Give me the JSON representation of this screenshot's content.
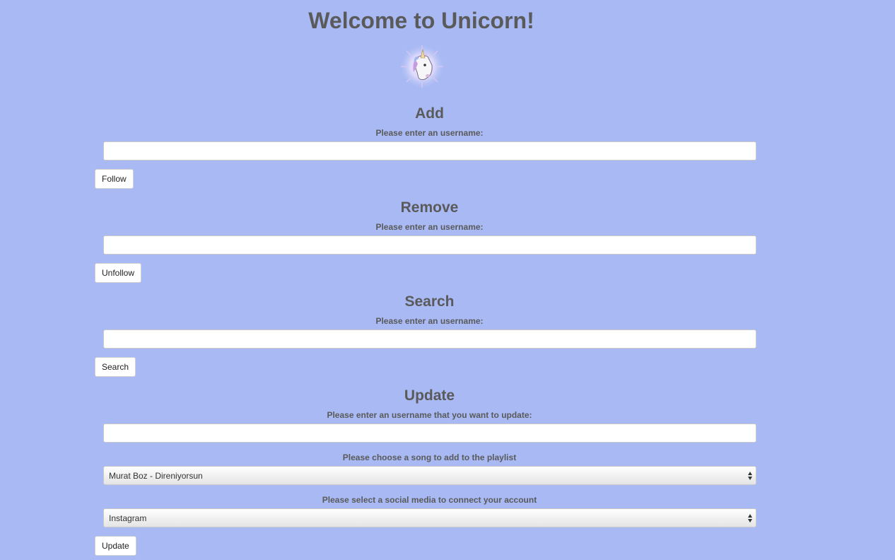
{
  "title": "Welcome to Unicorn!",
  "logo_icon": "unicorn-icon",
  "add": {
    "heading": "Add",
    "label": "Please enter an username:",
    "input_value": "",
    "button_label": "Follow"
  },
  "remove": {
    "heading": "Remove",
    "label": "Please enter an username:",
    "input_value": "",
    "button_label": "Unfollow"
  },
  "search": {
    "heading": "Search",
    "label": "Please enter an username:",
    "input_value": "",
    "button_label": "Search"
  },
  "update": {
    "heading": "Update",
    "username_label": "Please enter an username that you want to update:",
    "username_value": "",
    "song_label": "Please choose a song to add to the playlist",
    "song_selected": "Murat Boz - Direniyorsun",
    "social_label": "Please select a social media to connect your account",
    "social_selected": "Instagram",
    "button_label": "Update"
  },
  "colors": {
    "background": "#a8b9f3",
    "text": "#5a5a5a"
  }
}
